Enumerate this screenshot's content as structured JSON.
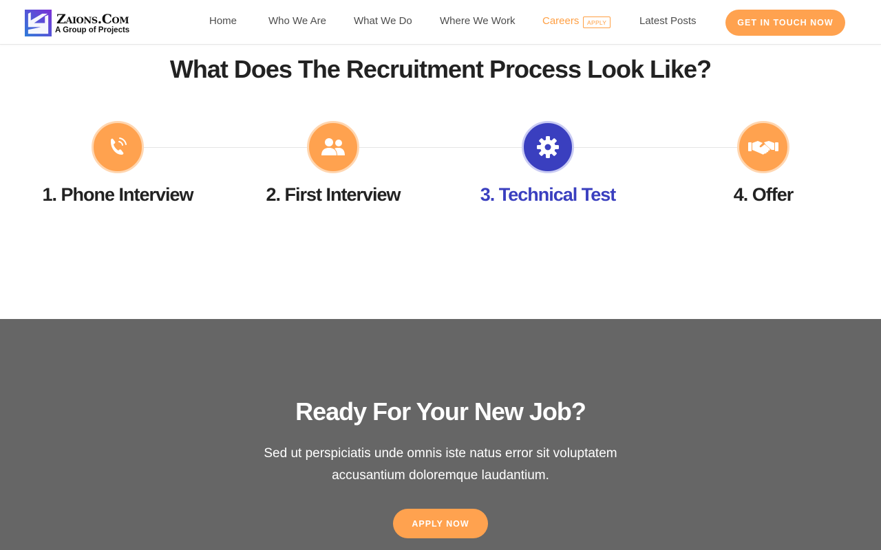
{
  "header": {
    "logo": {
      "title": "Zaions.Com",
      "subtitle": "A Group of Projects"
    },
    "nav": [
      {
        "label": "Home",
        "active": false
      },
      {
        "label": "Who We Are",
        "active": false
      },
      {
        "label": "What We Do",
        "active": false
      },
      {
        "label": "Where We Work",
        "active": false
      },
      {
        "label": "Careers",
        "active": true,
        "badge": "APPLY"
      },
      {
        "label": "Latest Posts",
        "active": false
      }
    ],
    "cta_label": "GET IN TOUCH NOW"
  },
  "process": {
    "title": "What Does The Recruitment Process Look Like?",
    "steps": [
      {
        "label": "1. Phone Interview",
        "icon": "phone-icon"
      },
      {
        "label": "2. First Interview",
        "icon": "users-icon"
      },
      {
        "label": "3. Technical Test",
        "icon": "gear-icon"
      },
      {
        "label": "4. Offer",
        "icon": "handshake-icon"
      }
    ]
  },
  "cta_section": {
    "title": "Ready For Your New Job?",
    "text": "Sed ut perspiciatis unde omnis iste natus error sit voluptatem accusantium doloremque laudantium.",
    "button_label": "APPLY NOW"
  },
  "colors": {
    "accent_orange": "#ffa24f",
    "accent_blue": "#3a3fbf",
    "cta_background": "#666666"
  }
}
